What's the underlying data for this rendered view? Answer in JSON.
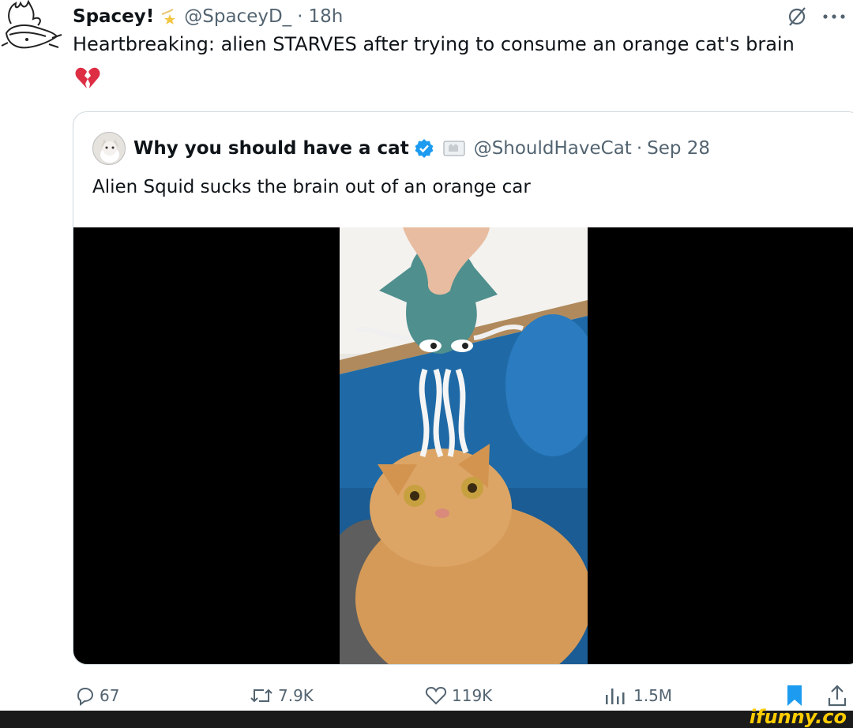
{
  "tweet": {
    "display_name": "Spacey!",
    "handle": "@SpaceyD_",
    "separator": "·",
    "time": "18h",
    "text": "Heartbreaking: alien STARVES after trying to consume an orange cat's brain"
  },
  "quoted_tweet": {
    "display_name": "Why you should have a cat",
    "handle": "@ShouldHaveCat",
    "separator": "·",
    "date": "Sep 28",
    "text": "Alien Squid sucks the brain out of an orange car"
  },
  "actions": {
    "replies": "67",
    "reposts": "7.9K",
    "likes": "119K",
    "views": "1.5M"
  },
  "watermark": "ifunny.co",
  "icons": [
    "grok-icon",
    "more-icon",
    "broken-heart-icon",
    "verified-badge-icon",
    "reply-icon",
    "repost-icon",
    "like-icon",
    "views-icon",
    "bookmark-icon",
    "share-icon"
  ],
  "colors": {
    "verified": "#1d9bf0",
    "bookmark": "#1d9bf0",
    "muted": "#536471",
    "watermark": "#ffcc00"
  }
}
